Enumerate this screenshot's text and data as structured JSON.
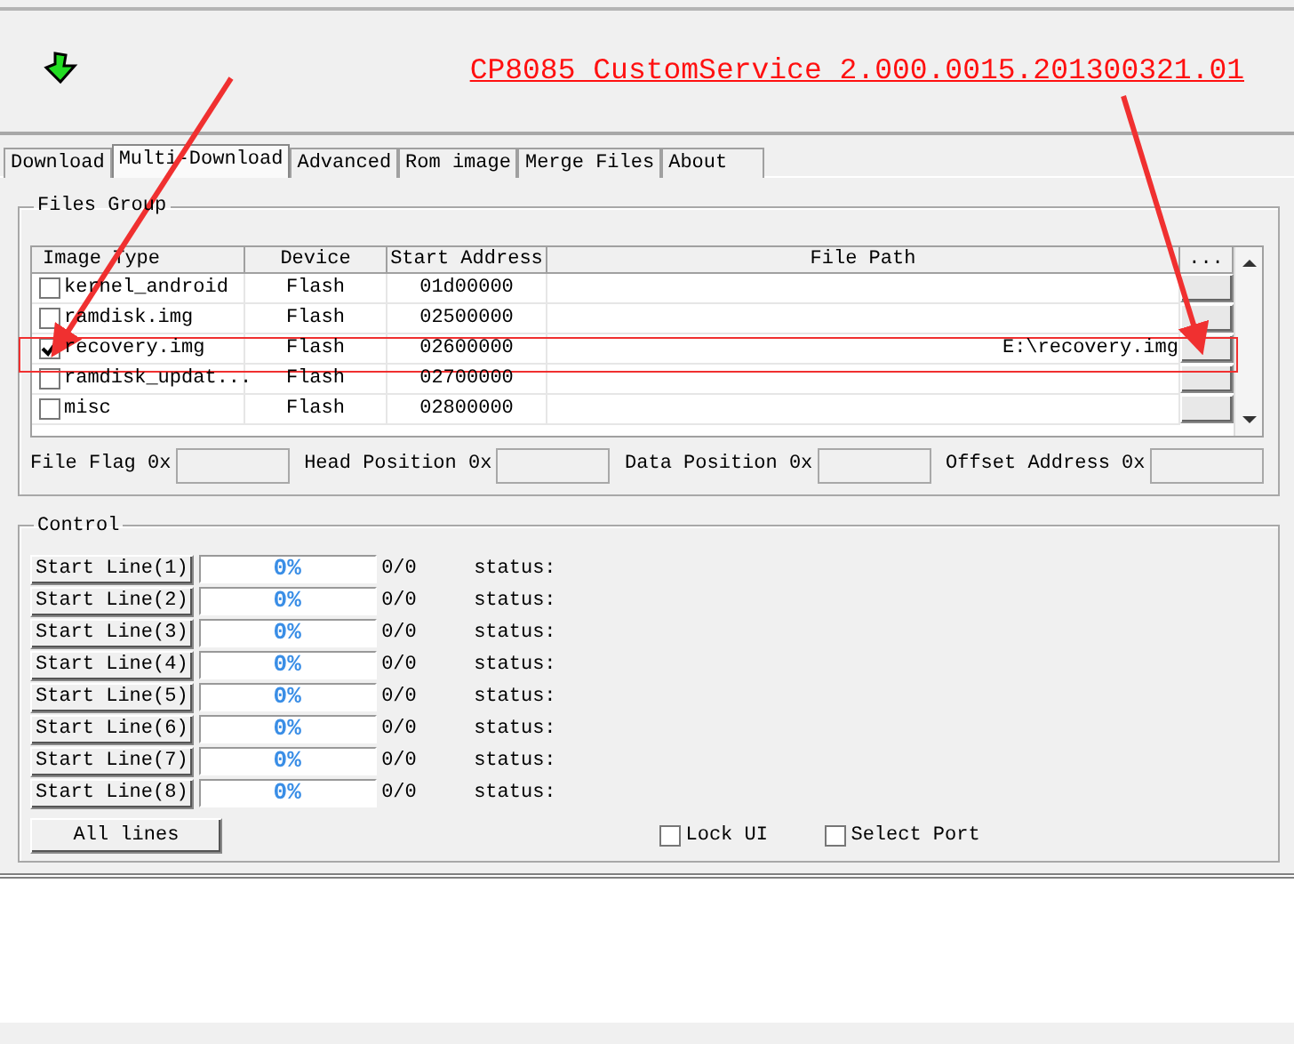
{
  "title_link": "CP8085 CustomService 2.000.0015.201300321.01",
  "tabs": [
    {
      "label": "Download",
      "selected": false
    },
    {
      "label": "Multi-Download",
      "selected": true
    },
    {
      "label": "Advanced",
      "selected": false
    },
    {
      "label": "Rom image",
      "selected": false
    },
    {
      "label": "Merge Files",
      "selected": false
    },
    {
      "label": "About",
      "selected": false
    }
  ],
  "files_group": {
    "label": "Files Group",
    "columns": [
      "Image Type",
      "Device",
      "Start Address",
      "File Path",
      "..."
    ],
    "rows": [
      {
        "image_type": "kernel_android",
        "checked": false,
        "device": "Flash",
        "start_address": "01d00000",
        "file_path": ""
      },
      {
        "image_type": "ramdisk.img",
        "checked": false,
        "device": "Flash",
        "start_address": "02500000",
        "file_path": ""
      },
      {
        "image_type": "recovery.img",
        "checked": true,
        "device": "Flash",
        "start_address": "02600000",
        "file_path": "E:\\recovery.img"
      },
      {
        "image_type": "ramdisk_updat...",
        "checked": false,
        "device": "Flash",
        "start_address": "02700000",
        "file_path": ""
      },
      {
        "image_type": "misc",
        "checked": false,
        "device": "Flash",
        "start_address": "02800000",
        "file_path": ""
      }
    ],
    "fields": [
      {
        "label": "File Flag 0x"
      },
      {
        "label": "Head Position 0x"
      },
      {
        "label": "Data Position 0x"
      },
      {
        "label": "Offset Address 0x"
      }
    ]
  },
  "control": {
    "label": "Control",
    "lines": [
      {
        "button": "Start Line(1)",
        "level": 0,
        "percent": "0%",
        "count": "0/0",
        "status": "status:"
      },
      {
        "button": "Start Line(2)",
        "level": 0,
        "percent": "0%",
        "count": "0/0",
        "status": "status:"
      },
      {
        "button": "Start Line(3)",
        "level": 0,
        "percent": "0%",
        "count": "0/0",
        "status": "status:"
      },
      {
        "button": "Start Line(4)",
        "level": 0,
        "percent": "0%",
        "count": "0/0",
        "status": "status:"
      },
      {
        "button": "Start Line(5)",
        "level": 0,
        "percent": "0%",
        "count": "0/0",
        "status": "status:"
      },
      {
        "button": "Start Line(6)",
        "level": 0,
        "percent": "0%",
        "count": "0/0",
        "status": "status:"
      },
      {
        "button": "Start Line(7)",
        "level": 0,
        "percent": "0%",
        "count": "0/0",
        "status": "status:"
      },
      {
        "button": "Start Line(8)",
        "level": 0,
        "percent": "0%",
        "count": "0/0",
        "status": "status:"
      }
    ],
    "all_lines_button": "All lines",
    "options": [
      {
        "label": "Lock UI",
        "checked": false
      },
      {
        "label": "Select Port",
        "checked": false
      }
    ]
  }
}
